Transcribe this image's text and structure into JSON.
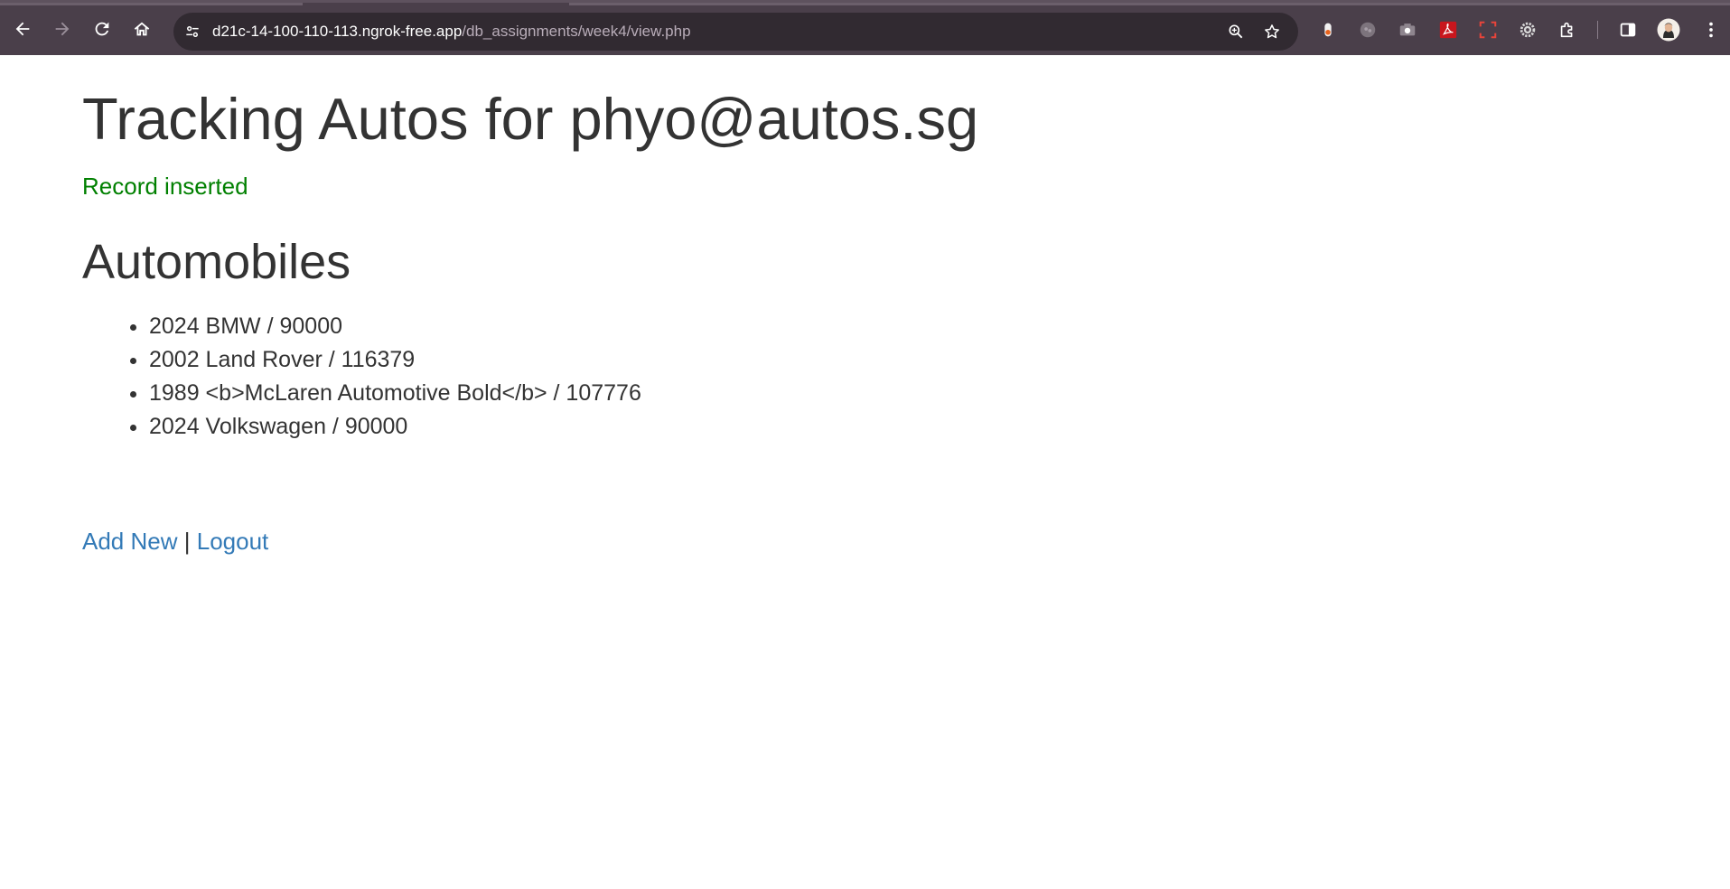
{
  "browser": {
    "url_host": "d21c-14-100-110-113.ngrok-free.app",
    "url_path": "/db_assignments/week4/view.php",
    "icons": [
      "back-icon",
      "forward-icon",
      "reload-icon",
      "home-icon",
      "site-info-icon",
      "zoom-icon",
      "bookmark-star-icon",
      "extension-icons",
      "side-panel-icon",
      "profile-avatar",
      "menu-icon"
    ],
    "colors": {
      "toolbar": "#4a3f4a",
      "omnibox": "#312a31"
    }
  },
  "page": {
    "title": "Tracking Autos for phyo@autos.sg",
    "flash_message": "Record inserted",
    "flash_color": "#008000",
    "section_title": "Automobiles",
    "autos": [
      "2024 BMW / 90000",
      "2002 Land Rover / 116379",
      "1989 <b>McLaren Automotive Bold</b> / 107776",
      "2024 Volkswagen / 90000"
    ],
    "links": {
      "add_new": "Add New",
      "separator": "|",
      "logout": "Logout",
      "color": "#337ab7"
    }
  }
}
